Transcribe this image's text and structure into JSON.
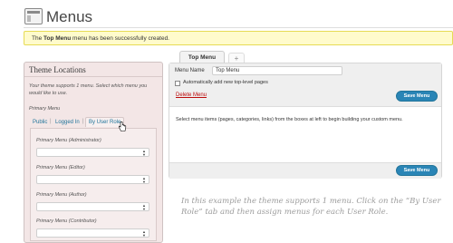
{
  "header": {
    "title": "Menus",
    "icon": "menus-icon"
  },
  "notice": {
    "prefix": "The ",
    "menu_name": "Top Menu",
    "suffix": " menu has been successfully created."
  },
  "theme_locations": {
    "title": "Theme Locations",
    "description": "Your theme supports 1 menu. Select which menu you would like to use.",
    "primary_menu_label": "Primary Menu",
    "tabs": [
      {
        "label": "Public",
        "active": false
      },
      {
        "label": "Logged In",
        "active": false
      },
      {
        "label": "By User Role",
        "active": true
      }
    ],
    "roles": [
      {
        "label": "Primary Menu (Administrator)",
        "value": ""
      },
      {
        "label": "Primary Menu (Editor)",
        "value": ""
      },
      {
        "label": "Primary Menu (Author)",
        "value": ""
      },
      {
        "label": "Primary Menu (Contributor)",
        "value": ""
      }
    ]
  },
  "menu_tabs": {
    "active_label": "Top Menu",
    "add_label": "+"
  },
  "editor": {
    "name_label": "Menu Name",
    "name_value": "Top Menu",
    "auto_add_label": "Automatically add new top-level pages",
    "auto_add_checked": false,
    "delete_label": "Delete Menu",
    "save_label": "Save Menu",
    "instructions": "Select menu items (pages, categories, links) from the boxes at left to begin building your custom menu."
  },
  "caption": "In this example the theme supports 1 menu. Click on the “By User Role” tab and then assign menus for each User Role.",
  "colors": {
    "link": "#21759b",
    "button": "#2a85b6",
    "delete": "#bc0b0b",
    "notice_bg": "#fffbcc",
    "panel_bg": "#f3e6e6"
  }
}
